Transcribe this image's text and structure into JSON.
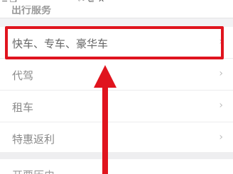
{
  "toolbar": {
    "glyphs": [
      "≡",
      "❐",
      "✂",
      "⧉",
      "✕"
    ]
  },
  "section": {
    "title": "出行服务"
  },
  "menu": {
    "items": [
      {
        "label": "快车、专车、豪华车",
        "icon": "chevron-right-icon"
      },
      {
        "label": "代驾",
        "icon": "chevron-right-icon"
      },
      {
        "label": "租车",
        "icon": "chevron-right-icon"
      },
      {
        "label": "特惠返利",
        "icon": "chevron-right-icon"
      }
    ],
    "bottom_item": "开票历史"
  },
  "chevron": "›",
  "annotation": {
    "color": "#e0141e"
  }
}
